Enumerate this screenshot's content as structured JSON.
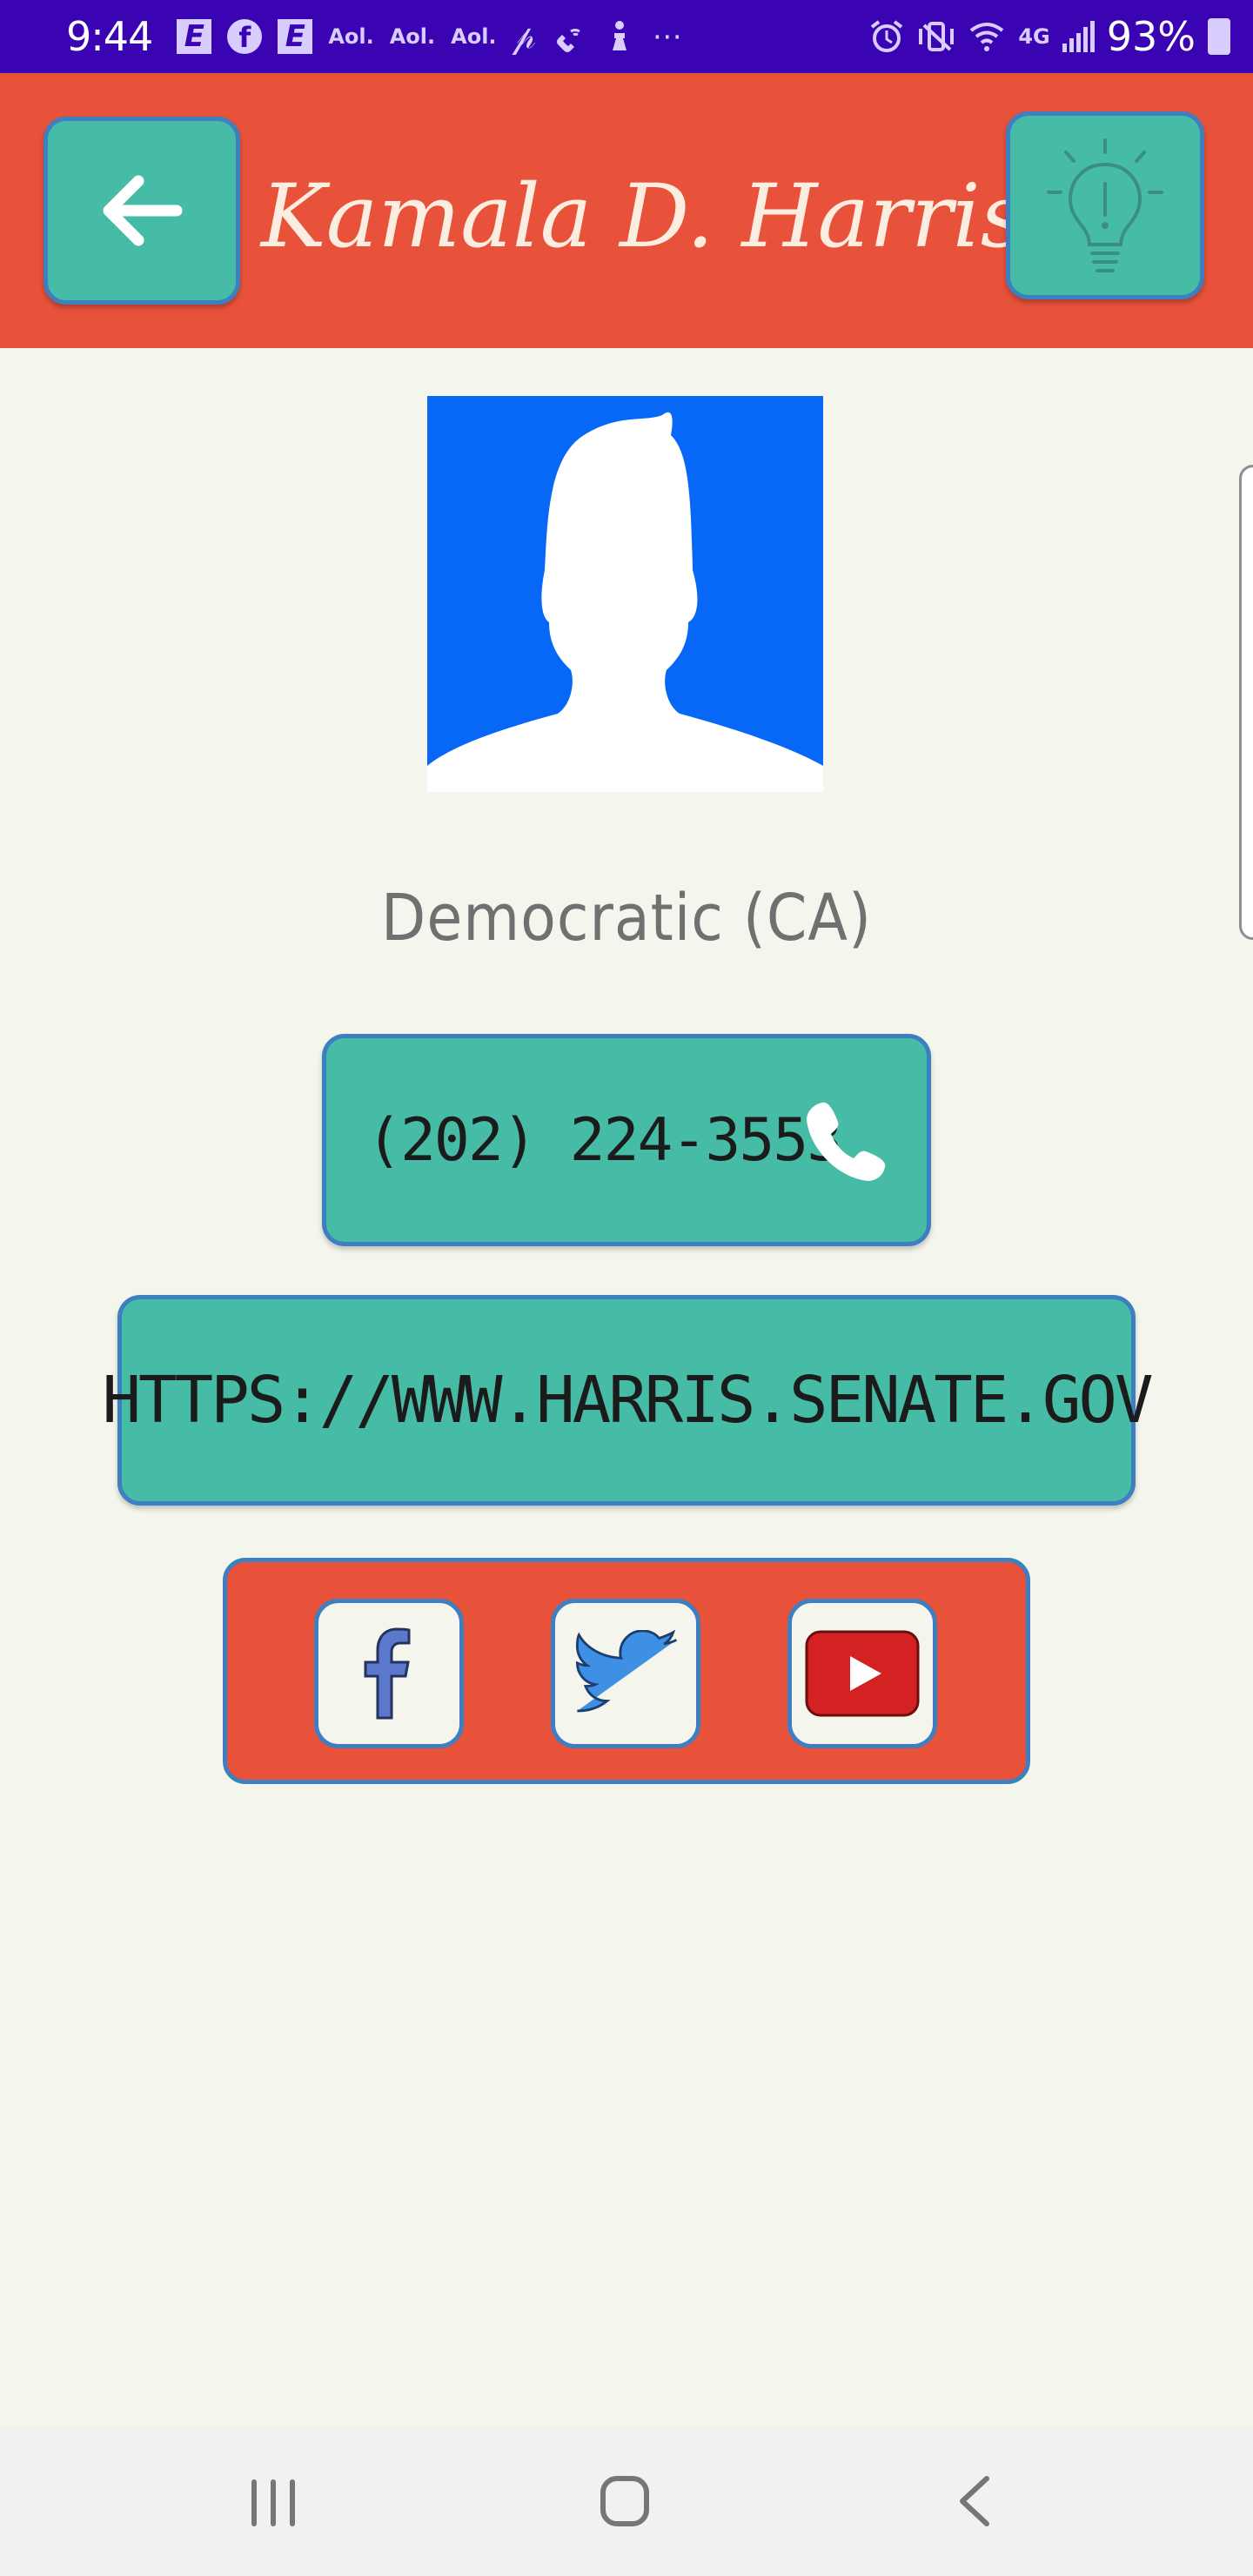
{
  "status_bar": {
    "time": "9:44",
    "left_icons": [
      "e-news-icon",
      "facebook-icon",
      "e-news-icon",
      "aol-icon",
      "aol-icon",
      "aol-icon",
      "pinterest-icon",
      "wifi-calling-icon",
      "accessibility-icon",
      "more-icon"
    ],
    "aol_label": "Aol.",
    "right_icons": [
      "alarm-icon",
      "mute-vibrate-icon",
      "wifi-icon",
      "lte-icon",
      "signal-icon",
      "battery-charging-icon"
    ],
    "network_label": "4G",
    "battery_percent": "93%"
  },
  "app_bar": {
    "title": "Kamala D. Harris",
    "back_icon": "arrow-left-icon",
    "hint_icon": "lightbulb-icon"
  },
  "profile": {
    "party": "Democratic (CA)",
    "phone": "(202) 224-3553",
    "website": "HTTPS://WWW.HARRIS.SENATE.GOV"
  },
  "social": {
    "items": [
      "facebook-icon",
      "twitter-icon",
      "youtube-icon"
    ]
  },
  "colors": {
    "status_bar": "#3a04b2",
    "app_bar": "#e8523b",
    "button_teal": "#46bba6",
    "button_border": "#3d7fc1",
    "background": "#f4f5ec",
    "avatar_bg": "#0767f7"
  },
  "nav_bar": {
    "items": [
      "recents-icon",
      "home-icon",
      "back-icon"
    ]
  }
}
